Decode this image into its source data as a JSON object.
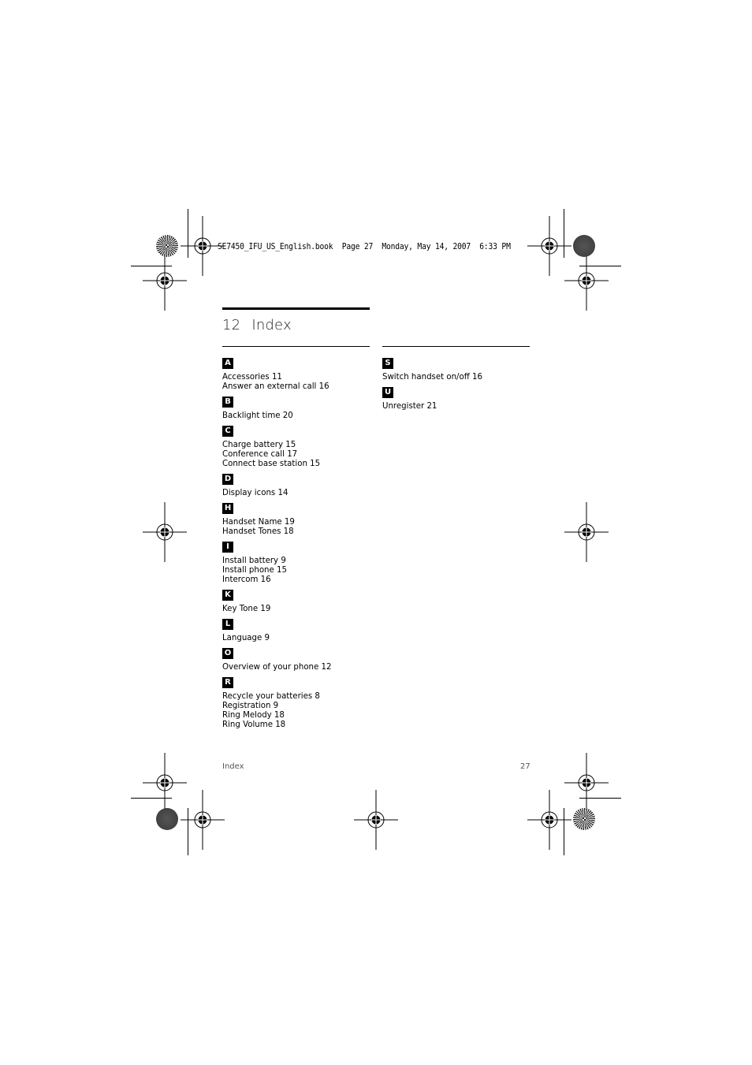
{
  "header": {
    "slug_line": "SE7450_IFU_US_English.book  Page 27  Monday, May 14, 2007  6:33 PM"
  },
  "chapter": {
    "number": "12",
    "title": "Index"
  },
  "index": {
    "left_column": [
      {
        "letter": "A",
        "entries": [
          "Accessories 11",
          "Answer an external call 16"
        ]
      },
      {
        "letter": "B",
        "entries": [
          "Backlight time 20"
        ]
      },
      {
        "letter": "C",
        "entries": [
          "Charge battery 15",
          "Conference call 17",
          "Connect base station 15"
        ]
      },
      {
        "letter": "D",
        "entries": [
          "Display icons 14"
        ]
      },
      {
        "letter": "H",
        "entries": [
          "Handset Name 19",
          "Handset Tones 18"
        ]
      },
      {
        "letter": "I",
        "entries": [
          "Install battery 9",
          "Install phone 15",
          "Intercom 16"
        ]
      },
      {
        "letter": "K",
        "entries": [
          "Key Tone 19"
        ]
      },
      {
        "letter": "L",
        "entries": [
          "Language 9"
        ]
      },
      {
        "letter": "O",
        "entries": [
          "Overview of your phone 12"
        ]
      },
      {
        "letter": "R",
        "entries": [
          "Recycle your batteries 8",
          "Registration 9",
          "Ring Melody 18",
          "Ring Volume 18"
        ]
      }
    ],
    "right_column": [
      {
        "letter": "S",
        "entries": [
          "Switch handset on/off 16"
        ]
      },
      {
        "letter": "U",
        "entries": [
          "Unregister 21"
        ]
      }
    ]
  },
  "footer": {
    "section_name": "Index",
    "page_number": "27"
  }
}
